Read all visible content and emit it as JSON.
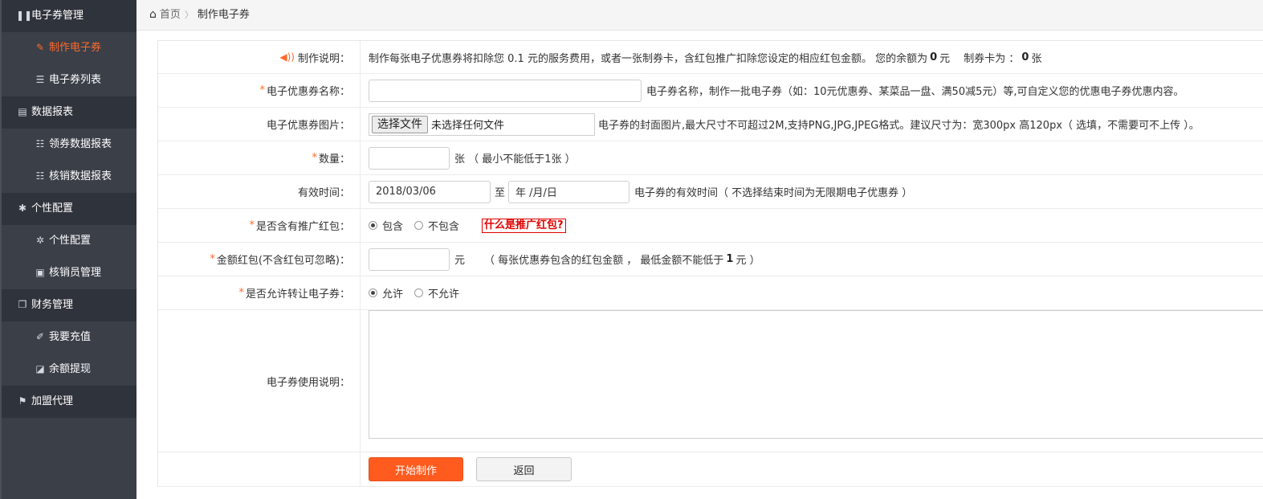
{
  "sidebar": {
    "items": [
      {
        "type": "group",
        "label": "电子券管理",
        "icon": "book-icon",
        "glyph": "❚❚"
      },
      {
        "type": "sub",
        "label": "制作电子券",
        "icon": "pencil-icon",
        "glyph": "✎",
        "active": true
      },
      {
        "type": "sub",
        "label": "电子券列表",
        "icon": "list-icon",
        "glyph": "☰"
      },
      {
        "type": "group",
        "label": "数据报表",
        "icon": "word-file-icon",
        "glyph": "▤"
      },
      {
        "type": "sub",
        "label": "领券数据报表",
        "icon": "list-alt-icon",
        "glyph": "☷"
      },
      {
        "type": "sub",
        "label": "核销数据报表",
        "icon": "list-alt-icon",
        "glyph": "☷"
      },
      {
        "type": "group",
        "label": "个性配置",
        "icon": "gear-icon",
        "glyph": "✱"
      },
      {
        "type": "sub",
        "label": "个性配置",
        "icon": "gear-icon",
        "glyph": "✲"
      },
      {
        "type": "sub",
        "label": "核销员管理",
        "icon": "lock-icon",
        "glyph": "▣"
      },
      {
        "type": "group",
        "label": "财务管理",
        "icon": "copy-icon",
        "glyph": "❐"
      },
      {
        "type": "sub",
        "label": "我要充值",
        "icon": "tag-icon",
        "glyph": "✐"
      },
      {
        "type": "sub",
        "label": "余额提现",
        "icon": "export-icon",
        "glyph": "◪"
      },
      {
        "type": "group",
        "label": "加盟代理",
        "icon": "flag-icon",
        "glyph": "⚑"
      }
    ]
  },
  "breadcrumb": {
    "home": "首页",
    "separator": "〉",
    "current": "制作电子券"
  },
  "form": {
    "description": {
      "label": "制作说明：",
      "text_a": "制作每张电子优惠券将扣除您 0.1 元的服务费用，或者一张制券卡，含红包推广扣除您设定的相应红包金额。 您的余额为",
      "balance": "0",
      "text_b": "元　 制券卡为 ：",
      "cards": "0",
      "text_c": "张"
    },
    "name": {
      "label": "电子优惠券名称：",
      "value": "",
      "note": "电子券名称，制作一批电子券（如：10元优惠券、某菜品一盘、满50减5元）等,可自定义您的优惠电子券优惠内容。"
    },
    "image": {
      "label": "电子优惠券图片：",
      "button": "选择文件",
      "file_status": "未选择任何文件",
      "note": "电子券的封面图片,最大尺寸不可超过2M,支持PNG,JPG,JPEG格式。建议尺寸为：宽300px 高120px（ 选填，不需要可不上传 ）。"
    },
    "quantity": {
      "label": "数量：",
      "value": "",
      "note": "张 （ 最小不能低于1张 ）"
    },
    "validity": {
      "label": "有效时间：",
      "start": "2018/03/06",
      "to": "至",
      "end_placeholder": "年 /月/日",
      "note": "电子券的有效时间（ 不选择结束时间为无限期电子优惠券 ）"
    },
    "redpacket": {
      "label": "是否含有推广红包：",
      "options": [
        "包含",
        "不包含"
      ],
      "selected": "包含",
      "help": "什么是推广红包?"
    },
    "amount": {
      "label": "金额红包(不含红包可忽略)：",
      "value": "",
      "unit": "元",
      "note_a": "（ 每张优惠券包含的红包金额 ， 最低金额不能低于",
      "min": "1",
      "note_b": "元 ）"
    },
    "transfer": {
      "label": "是否允许转让电子券：",
      "options": [
        "允许",
        "不允许"
      ],
      "selected": "允许"
    },
    "usage": {
      "label": "电子券使用说明：",
      "value": ""
    },
    "actions": {
      "submit": "开始制作",
      "back": "返回"
    }
  },
  "colors": {
    "accent": "#ff5b1f",
    "sidebar_bg": "#3a3f48",
    "sidebar_group_bg": "#2f333b",
    "danger": "#e10000"
  }
}
